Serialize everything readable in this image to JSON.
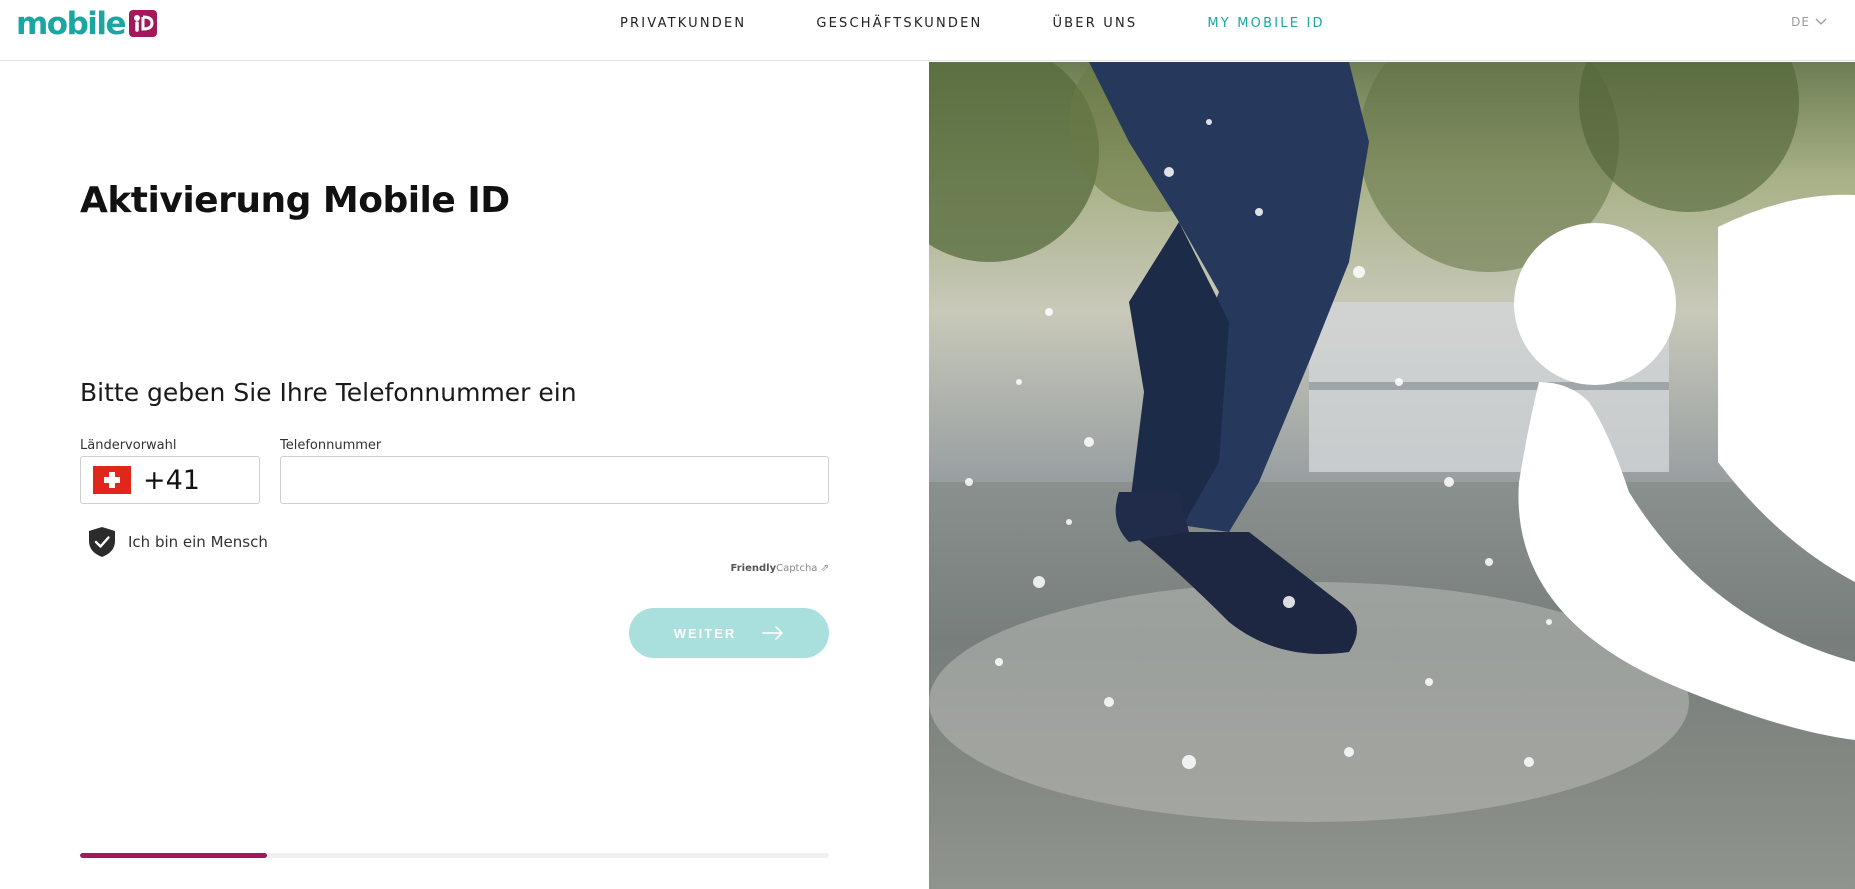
{
  "brand": {
    "logo_text": "mobile",
    "logo_color": "#1aa7a1",
    "badge_color": "#a3185b"
  },
  "nav": {
    "items": [
      "PRIVATKUNDEN",
      "GESCHÄFTSKUNDEN",
      "ÜBER UNS",
      "MY MOBILE ID"
    ],
    "active": "MY MOBILE ID"
  },
  "language": {
    "current": "DE",
    "icon": "chevron-down-icon"
  },
  "page": {
    "title": "Aktivierung Mobile ID",
    "subtitle": "Bitte geben Sie Ihre Telefonnummer ein"
  },
  "form": {
    "country_label": "Ländervorwahl",
    "country_code": "+41",
    "country_flag": "swiss-flag-icon",
    "phone_label": "Telefonnummer",
    "phone_value": "",
    "phone_placeholder": ""
  },
  "captcha": {
    "label": "Ich bin ein Mensch",
    "icon": "shield-check-icon",
    "brand_bold": "Friendly",
    "brand_light": "Captcha ⇗"
  },
  "submit": {
    "label": "WEITER",
    "icon": "arrow-right-icon",
    "color": "#a9dfdc"
  },
  "progress": {
    "fraction": 0.25,
    "color": "#a3185b"
  }
}
